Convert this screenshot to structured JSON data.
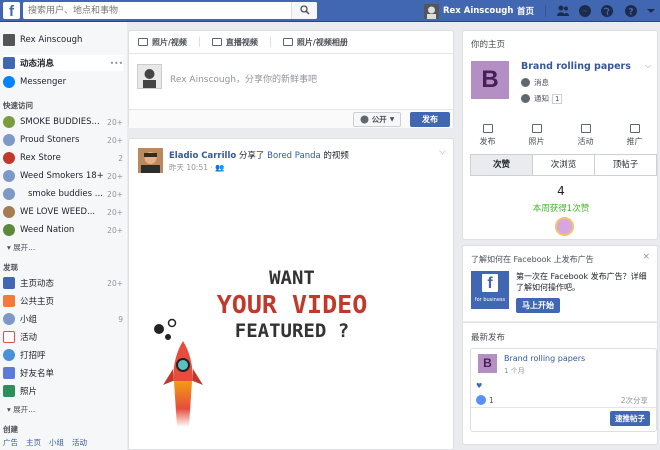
{
  "topbar": {
    "logo": "f",
    "search_placeholder": "搜索用户、地点和事物",
    "user_name": "Rex Ainscough",
    "home_label": "首页",
    "icons": [
      "friends-icon",
      "messenger-icon",
      "globe-icon",
      "help-icon"
    ]
  },
  "sidebar": {
    "profile": "Rex Ainscough",
    "news_feed": "动态消息",
    "messenger": "Messenger",
    "shortcuts_title": "快速访问",
    "shortcuts": [
      {
        "label": "SMOKE BUDDIES...",
        "count": "20+"
      },
      {
        "label": "Proud Stoners",
        "count": "20+"
      },
      {
        "label": "Rex Store",
        "count": "2"
      },
      {
        "label": "Weed Smokers 18+",
        "count": "20+"
      },
      {
        "label": "smoke buddies ...",
        "count": "20+"
      },
      {
        "label": "WE LOVE WEED...",
        "count": "20+"
      },
      {
        "label": "Weed Nation",
        "count": "20+"
      }
    ],
    "shortcuts_more": "展开...",
    "explore_title": "发现",
    "explore": [
      {
        "label": "主页动态",
        "count": "20+"
      },
      {
        "label": "公共主页",
        "count": ""
      },
      {
        "label": "小组",
        "count": "9"
      },
      {
        "label": "活动",
        "count": ""
      },
      {
        "label": "打招呼",
        "count": ""
      },
      {
        "label": "好友名单",
        "count": ""
      },
      {
        "label": "照片",
        "count": ""
      }
    ],
    "explore_more": "展开...",
    "create_title": "创建",
    "create_links": [
      "广告",
      "主页",
      "小组",
      "活动"
    ]
  },
  "composer": {
    "tabs": [
      "照片/视频",
      "直播视频",
      "照片/视频相册"
    ],
    "placeholder": "Rex Ainscough，分享你的新鲜事吧",
    "privacy_label": "公开",
    "post_label": "发布"
  },
  "post": {
    "author": "Eladio Carrillo",
    "action_text": " 分享了 ",
    "shared_from": "Bored Panda",
    "suffix": " 的视频",
    "time": "昨天 10:51 · ",
    "promo": {
      "line1": "WANT",
      "line2": "YOUR VIDEO",
      "line3": "FEATURED ?",
      "line1_color": "#333333",
      "line2_color": "#c0392b",
      "line3_color": "#333333"
    }
  },
  "right": {
    "your_pages_title": "你的主页",
    "page_initial": "B",
    "page_name": "Brand rolling papers",
    "messages_label": "消息",
    "notifications_label": "通知",
    "notifications_count": "1",
    "actions": [
      "发布",
      "照片",
      "活动",
      "推广"
    ],
    "tabs": [
      "次赞",
      "次浏览",
      "顶帖子"
    ],
    "stat_value": "4",
    "stat_label": "本周获得1次赞",
    "ad_title": "了解如何在 Facebook 上发布广告",
    "ad_text": "第一次在 Facebook 发布广告？详细了解如何操作吧。",
    "ad_logo_sub": "for business",
    "ad_button": "马上开始",
    "recent_title": "最新发布",
    "recent_page": "Brand rolling papers",
    "recent_time": "1 个月",
    "recent_likes": "1",
    "recent_shares": "2次分享",
    "recent_button": "速推帖子"
  }
}
